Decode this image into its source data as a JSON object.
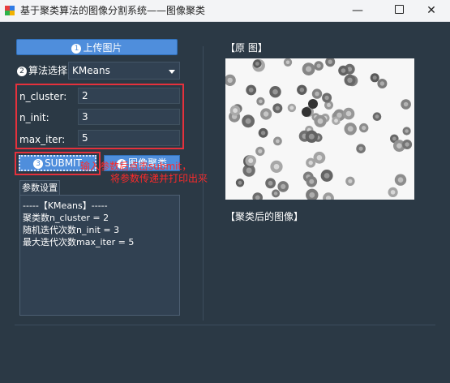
{
  "window": {
    "title": "基于聚类算法的图像分割系统——图像聚类",
    "controls": {
      "minimize": "—",
      "close": "✕"
    }
  },
  "icon_colors": [
    "#e83e3e",
    "#2f7be5",
    "#2bb34a",
    "#f2b300"
  ],
  "upload_button": {
    "num": "1",
    "label": "上传图片"
  },
  "algorithm": {
    "num": "2",
    "label": "算法选择:",
    "selected": "KMeans"
  },
  "params": [
    {
      "label": "n_cluster:",
      "value": "2"
    },
    {
      "label": "n_init:",
      "value": "3"
    },
    {
      "label": "max_iter:",
      "value": "5"
    }
  ],
  "submit_button": {
    "num": "3",
    "label": "SUBMIT"
  },
  "cluster_button": {
    "num": "4",
    "label": "图像聚类"
  },
  "tab": {
    "label": "参数设置"
  },
  "output_lines": [
    "-----【KMeans】-----",
    "聚类数n_cluster = 2",
    "随机迭代次数n_init = 3",
    "最大迭代次数max_iter = 5"
  ],
  "annotation": {
    "line1": "输入参数后点击submit，",
    "line2": "将参数传递并打印出来"
  },
  "original_image_label": "【原 图】",
  "result_image_label": "【聚类后的图像】",
  "colors": {
    "background": "#2b3945",
    "panel": "#314152",
    "button_blue": "#4f8edc",
    "highlight_red": "#e5313c",
    "annotation_red": "#ff2a2a"
  }
}
